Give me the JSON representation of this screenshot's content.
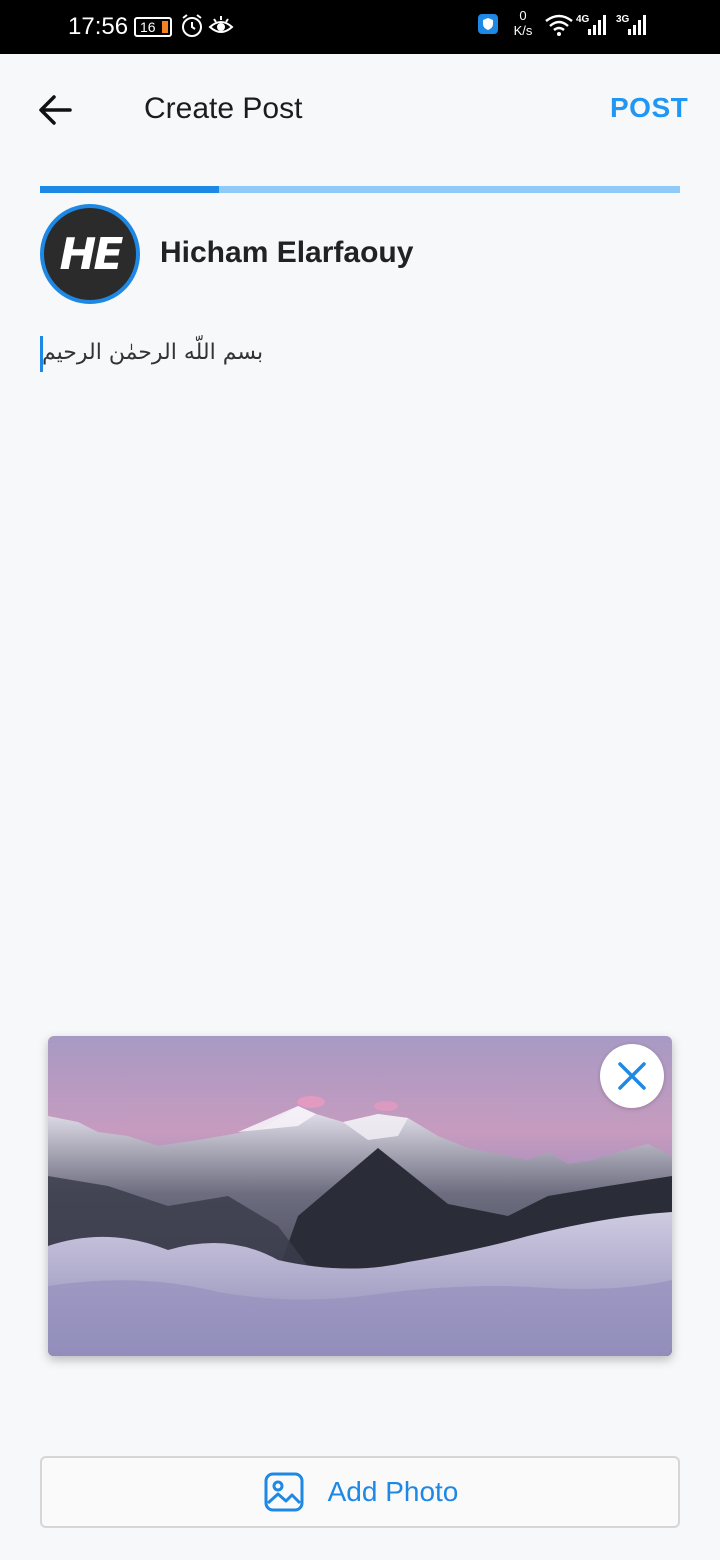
{
  "status_bar": {
    "time": "17:56",
    "battery": "16",
    "net_speed_value": "0",
    "net_speed_unit": "K/s",
    "net_4g": "4G",
    "net_3g": "3G",
    "icons": [
      "alarm-icon",
      "eye-icon",
      "vpn-shield-icon",
      "wifi-icon",
      "signal-icon"
    ]
  },
  "app_bar": {
    "title": "Create Post",
    "post_label": "POST"
  },
  "progress": {
    "fraction": 0.28
  },
  "user": {
    "name": "Hicham Elarfaouy",
    "avatar_initials": "HE"
  },
  "composer": {
    "text": "بسم اللّه الرحمٰن الرحيم"
  },
  "attachment": {
    "kind": "image",
    "description_icon": "mountain-photo",
    "remove_icon": "close-icon"
  },
  "actions": {
    "add_photo_label": "Add Photo",
    "add_photo_icon": "image-icon"
  },
  "colors": {
    "accent": "#1e88e5",
    "post": "#2196f3",
    "progress_track": "#90caf9",
    "background": "#f7f8fa"
  }
}
